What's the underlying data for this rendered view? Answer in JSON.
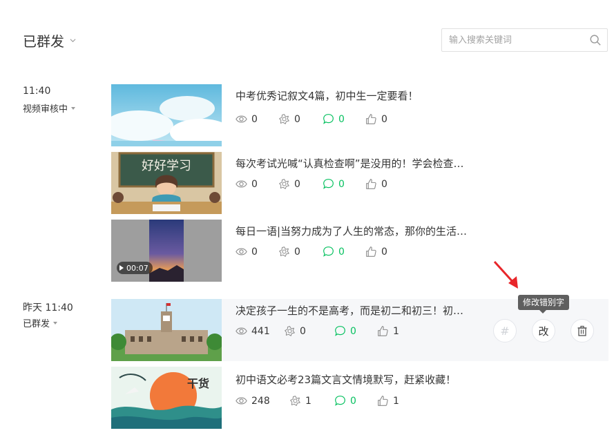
{
  "header": {
    "title": "已群发"
  },
  "search": {
    "placeholder": "输入搜索关键词"
  },
  "groups": [
    {
      "time": "11:40",
      "status": "视频审核中"
    },
    {
      "time": "昨天 11:40",
      "status": "已群发"
    }
  ],
  "articles": [
    {
      "title": "中考优秀记叙文4篇，初中生一定要看！",
      "reads": "0",
      "shares": "0",
      "comments": "0",
      "likes": "0"
    },
    {
      "title": "每次考试光喊“认真检查啊”是没用的！学会检查…",
      "reads": "0",
      "shares": "0",
      "comments": "0",
      "likes": "0"
    },
    {
      "title": "每日一语|当努力成为了人生的常态，那你的生活…",
      "reads": "0",
      "shares": "0",
      "comments": "0",
      "likes": "0",
      "video_duration": "00:07"
    },
    {
      "title": "决定孩子一生的不是高考，而是初二和初三！初…",
      "reads": "441",
      "shares": "0",
      "comments": "0",
      "likes": "1"
    },
    {
      "title": "初中语文必考23篇文言文情境默写，赶紧收藏！",
      "reads": "248",
      "shares": "1",
      "comments": "0",
      "likes": "1"
    }
  ],
  "thumb_texts": {
    "study_board": "好好学习",
    "dry_goods": "干货"
  },
  "actions": {
    "hash_label": "#",
    "edit_label": "改",
    "tooltip": "修改错别字"
  },
  "colors": {
    "comment_green": "#07c160",
    "annotation_red": "#e8262a"
  }
}
